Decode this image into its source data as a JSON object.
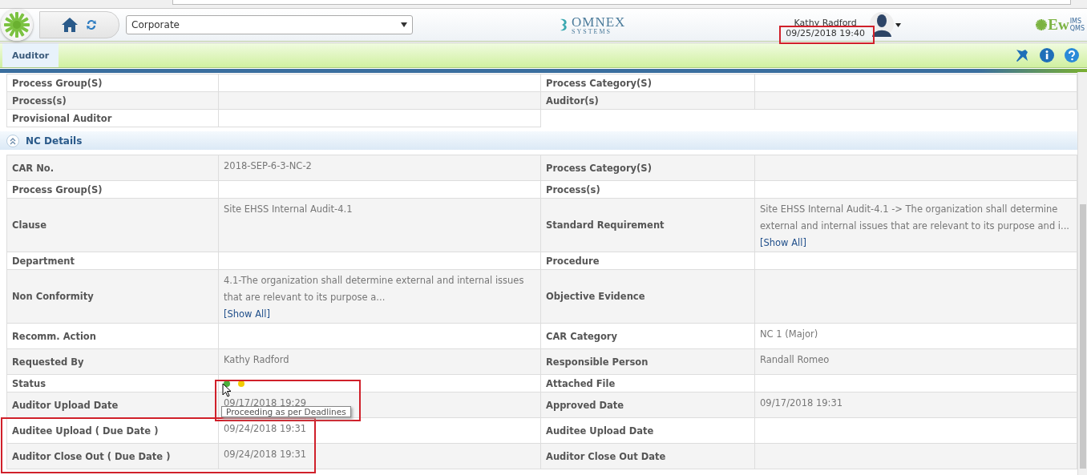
{
  "header": {
    "company_select": "Corporate",
    "logo_name": "OMNEX",
    "logo_tagline": "SYSTEMS",
    "user_name": "Kathy Radford",
    "datetime": {
      "text": "09/25/2018 19:40",
      "highlighted": true
    },
    "product_logo": {
      "name": "Ew",
      "line_1": "IMS",
      "line_2": "QMS"
    }
  },
  "tabs": [
    {
      "label": "Auditor",
      "selected": true
    }
  ],
  "general_table": {
    "rows": [
      [
        {
          "label": "Process Group(S)"
        },
        {
          "label": "Process Category(S)"
        }
      ],
      [
        {
          "label": "Process(s)"
        },
        {
          "label": "Auditor(s)"
        }
      ],
      [
        {
          "label": "Provisional Auditor"
        }
      ]
    ]
  },
  "nc_section": {
    "title": "NC Details",
    "expanded": true,
    "rows": [
      [
        {
          "label": "CAR No.",
          "kind": "text",
          "value": "2018-SEP-6-3-NC-2"
        },
        {
          "label": "Process Category(S)",
          "kind": "text"
        }
      ],
      [
        {
          "label": "Process Group(S)",
          "kind": "text"
        },
        {
          "label": "Process(s)",
          "kind": "text"
        }
      ],
      [
        {
          "label": "Clause",
          "kind": "text",
          "value": "Site EHSS Internal Audit-4.1"
        },
        {
          "label": "Standard Requirement",
          "kind": "text",
          "value": "Site EHSS Internal Audit-4.1 -> The organization shall determine external and internal issues that are relevant to its purpose and i...",
          "link": "[Show All]"
        }
      ],
      [
        {
          "label": "Department",
          "kind": "text"
        },
        {
          "label": "Procedure",
          "kind": "text"
        }
      ],
      [
        {
          "label": "Non Conformity",
          "kind": "text",
          "value": "4.1-The organization shall determine external and internal issues that are relevant to its purpose a...",
          "link": "[Show All]"
        },
        {
          "label": "Objective Evidence",
          "kind": "text"
        }
      ],
      [
        {
          "label": "Recomm. Action",
          "kind": "text"
        },
        {
          "label": "CAR Category",
          "kind": "text",
          "value": "NC 1 (Major)"
        }
      ],
      [
        {
          "label": "Requested By",
          "kind": "text",
          "value": "Kathy Radford"
        },
        {
          "label": "Responsible Person",
          "kind": "text",
          "value": "Randall Romeo"
        }
      ],
      [
        {
          "label": "Status",
          "kind": "status",
          "dots": [
            {
              "color": "#4caf3c",
              "tooltip": "Proceeding as per Deadlines"
            },
            {
              "color": "#f2cc00"
            }
          ],
          "highlighted": true,
          "label_highlighted": false
        },
        {
          "label": "Attached File",
          "kind": "text"
        }
      ],
      [
        {
          "label": "Auditor Upload Date",
          "kind": "text",
          "value": "09/17/2018 19:29",
          "highlighted": true,
          "label_highlighted": false
        },
        {
          "label": "Approved Date",
          "kind": "text",
          "value": "09/17/2018 19:31"
        }
      ],
      [
        {
          "label": "Auditee Upload ( Due Date )",
          "kind": "text",
          "value": "09/24/2018 19:31",
          "highlighted": true,
          "label_highlighted": true
        },
        {
          "label": "Auditee Upload Date",
          "kind": "text"
        }
      ],
      [
        {
          "label": "Auditor Close Out ( Due Date )",
          "kind": "text",
          "value": "09/24/2018 19:31",
          "highlighted": true,
          "label_highlighted": true
        },
        {
          "label": "Auditor Close Out Date",
          "kind": "text"
        }
      ]
    ]
  }
}
